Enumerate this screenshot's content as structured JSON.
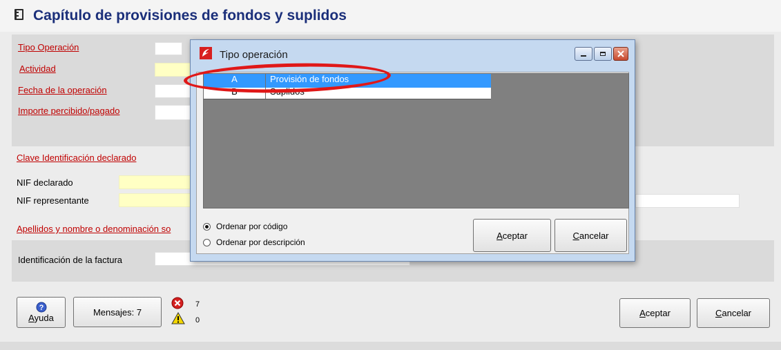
{
  "page": {
    "title": "Capítulo de provisiones de fondos y suplidos"
  },
  "form": {
    "tipo_operacion": "Tipo Operación",
    "actividad": "Actividad",
    "fecha_operacion": "Fecha de la operación",
    "importe": "Importe percibido/pagado",
    "clave_identificacion": "Clave Identificación declarado",
    "nif_declarado": "NIF declarado",
    "nif_representante": "NIF representante",
    "apellidos": "Apellidos y nombre o denominación so",
    "identificacion_factura": "Identificación de la factura"
  },
  "bottom": {
    "help_label": "Ayuda",
    "messages_label": "Mensajes: 7",
    "error_count": "7",
    "warning_count": "0",
    "accept_label": "Aceptar",
    "cancel_label": "Cancelar"
  },
  "dialog": {
    "title": "Tipo operación",
    "rows": [
      {
        "code": "A",
        "description": "Provisión de fondos",
        "selected": true
      },
      {
        "code": "B",
        "description": "Suplidos",
        "selected": false
      }
    ],
    "sort_by_code": "Ordenar por código",
    "sort_by_description": "Ordenar por descripción",
    "accept_label": "Aceptar",
    "cancel_label": "Cancelar"
  },
  "colors": {
    "title": "#1b2f7a",
    "required_label": "#c00000",
    "selection": "#3399ff",
    "highlight_ellipse": "#e01818"
  },
  "icons": {
    "title": "notebook-icon",
    "help": "question-icon",
    "error": "error-icon",
    "warning": "warning-icon",
    "dialog": "app-icon"
  }
}
